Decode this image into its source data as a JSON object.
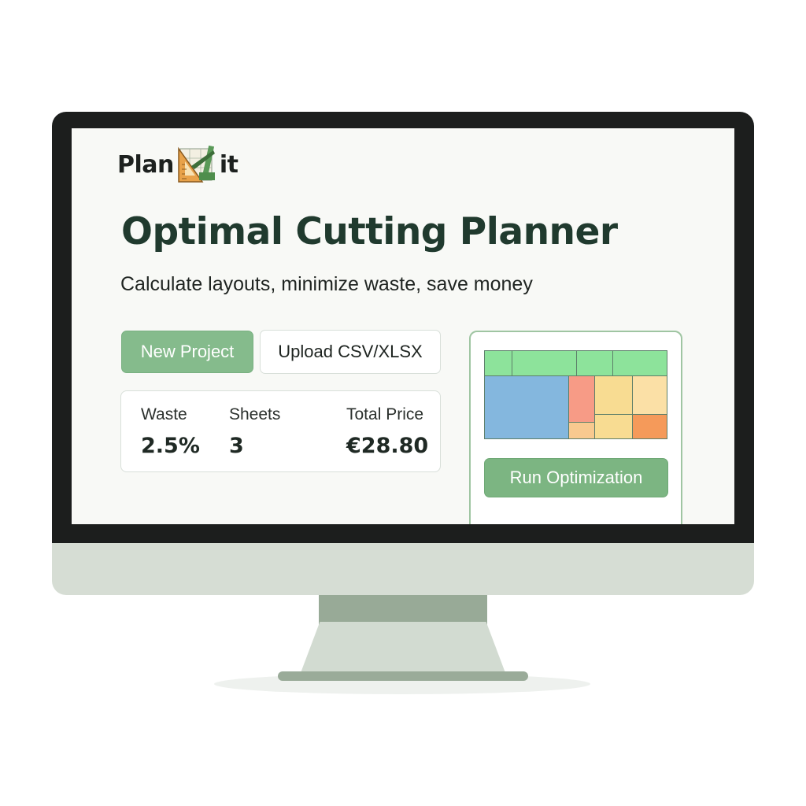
{
  "logo": {
    "prefix": "Plan",
    "suffix": "it"
  },
  "header": {
    "title": "Optimal Cutting Planner",
    "subtitle": "Calculate layouts, minimize waste, save money"
  },
  "actions": {
    "new_project_label": "New Project",
    "upload_label": "Upload CSV/XLSX",
    "run_label": "Run Optimization"
  },
  "stats": [
    {
      "label": "Waste",
      "value": "2.5%"
    },
    {
      "label": "Sheets",
      "value": "3"
    },
    {
      "label": "Total Price",
      "value": "€28.80"
    }
  ],
  "colors": {
    "accent": "#85bb8c",
    "title": "#203a2e",
    "piece_green": "#8de39b",
    "piece_blue": "#84b7de",
    "piece_red": "#f79b86",
    "piece_yellow": "#f8dc92",
    "piece_orange": "#f59a5a"
  },
  "icons": [
    "plan-it-ruler-logo-icon"
  ]
}
